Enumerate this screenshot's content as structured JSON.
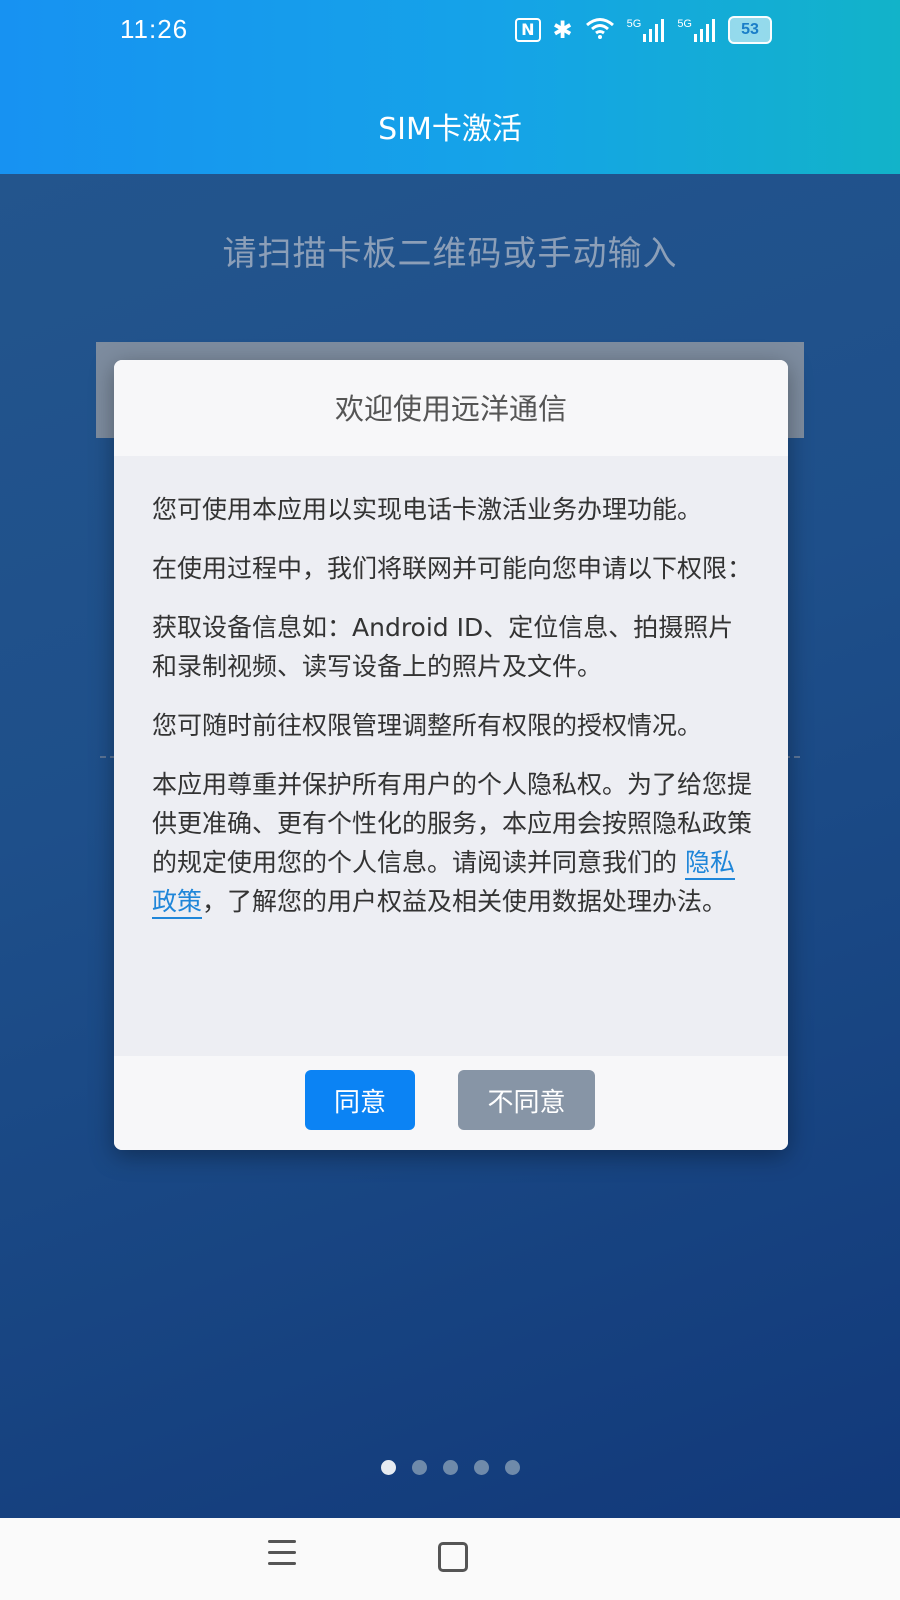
{
  "status_bar": {
    "time": "11:26",
    "nfc_icon": "N",
    "bluetooth_icon": "✱",
    "wifi_icon": "wifi",
    "signal_1": "5G",
    "signal_2": "5G",
    "battery": "53"
  },
  "header": {
    "title": "SIM卡激活"
  },
  "background": {
    "instruction": "请扫描卡板二维码或手动输入"
  },
  "dialog": {
    "title": "欢迎使用远洋通信",
    "paragraphs": {
      "p1": "您可使用本应用以实现电话卡激活业务办理功能。",
      "p2": "在使用过程中，我们将联网并可能向您申请以下权限：",
      "p3": "获取设备信息如：Android ID、定位信息、拍摄照片和录制视频、读写设备上的照片及文件。",
      "p4": "您可随时前往权限管理调整所有权限的授权情况。",
      "p5_before": "本应用尊重并保护所有用户的个人隐私权。为了给您提供更准确、更有个性化的服务，本应用会按照隐私政策的规定使用您的个人信息。请阅读并同意我们的 ",
      "p5_link": "隐私政策",
      "p5_after": "，了解您的用户权益及相关使用数据处理办法。"
    },
    "agree_label": "同意",
    "disagree_label": "不同意"
  },
  "pager": {
    "count": 5,
    "active_index": 0
  },
  "colors": {
    "header_start": "#1792f2",
    "header_end": "#12b3c9",
    "agree_button": "#0b83f4",
    "disagree_button": "#8795a6",
    "link": "#1f86d9"
  }
}
